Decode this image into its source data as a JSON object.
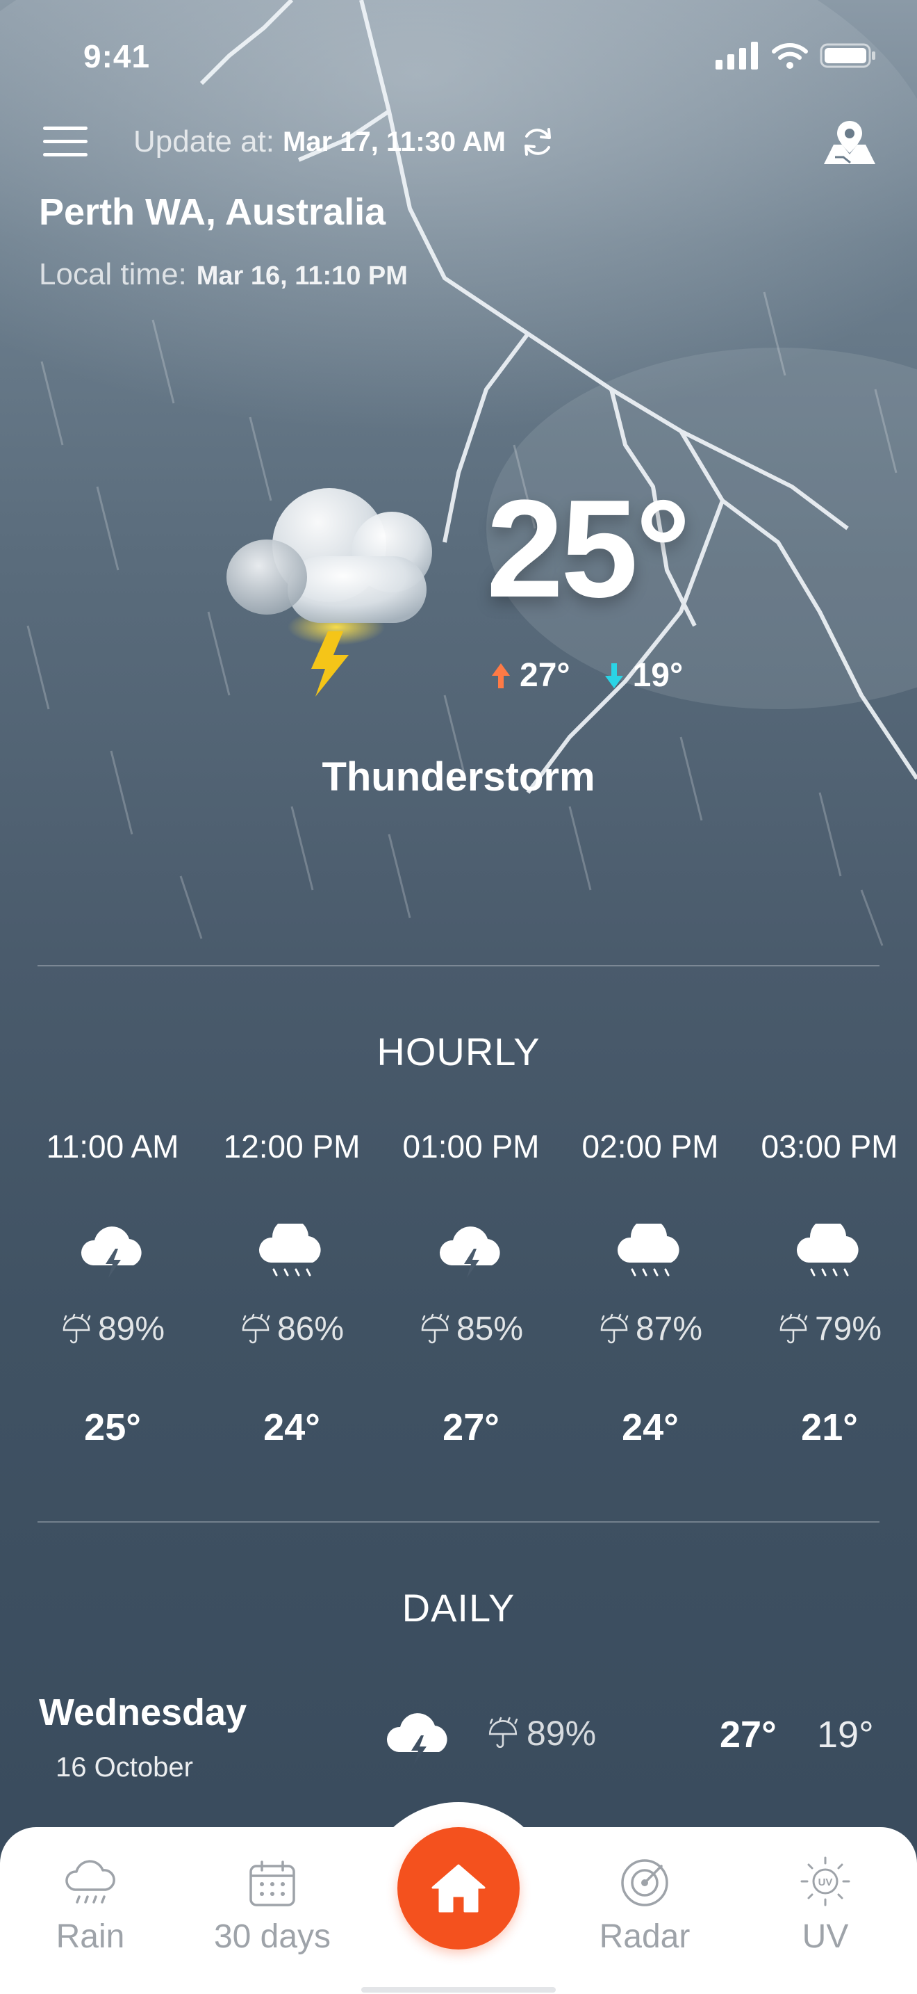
{
  "status_bar": {
    "time": "9:41"
  },
  "header": {
    "update_label": "Update at:",
    "update_value": "Mar 17, 11:30 AM",
    "location": "Perth WA, Australia",
    "local_time_label": "Local time:",
    "local_time_value": "Mar 16, 11:10 PM"
  },
  "current": {
    "temperature": "25°",
    "high": "27°",
    "low": "19°",
    "condition": "Thunderstorm",
    "icon": "thunder-cloud-icon"
  },
  "hourly": {
    "title": "HOURLY",
    "items": [
      {
        "time": "11:00 AM",
        "icon": "thunderstorm-icon",
        "precip": "89%",
        "temp": "25°"
      },
      {
        "time": "12:00 PM",
        "icon": "rain-cloud-icon",
        "precip": "86%",
        "temp": "24°"
      },
      {
        "time": "01:00 PM",
        "icon": "thunderstorm-icon",
        "precip": "85%",
        "temp": "27°"
      },
      {
        "time": "02:00 PM",
        "icon": "rain-cloud-icon",
        "precip": "87%",
        "temp": "24°"
      },
      {
        "time": "03:00 PM",
        "icon": "rain-cloud-icon",
        "precip": "79%",
        "temp": "21°"
      }
    ]
  },
  "daily": {
    "title": "DAILY",
    "items": [
      {
        "day": "Wednesday",
        "date": "16 October",
        "icon": "thunderstorm-icon",
        "precip": "89%",
        "high": "27°",
        "low": "19°"
      }
    ]
  },
  "nav": {
    "items": [
      {
        "label": "Rain",
        "icon": "rain-icon"
      },
      {
        "label": "30 days",
        "icon": "calendar-icon"
      },
      {
        "label": "",
        "icon": "home-icon"
      },
      {
        "label": "Radar",
        "icon": "radar-icon"
      },
      {
        "label": "UV",
        "icon": "uv-icon"
      }
    ]
  },
  "colors": {
    "accent": "#f4511e",
    "high_arrow": "#ff7a45",
    "low_arrow": "#2ad4e6",
    "lightning": "#f5c518",
    "nav_inactive": "#9ea3a9"
  }
}
